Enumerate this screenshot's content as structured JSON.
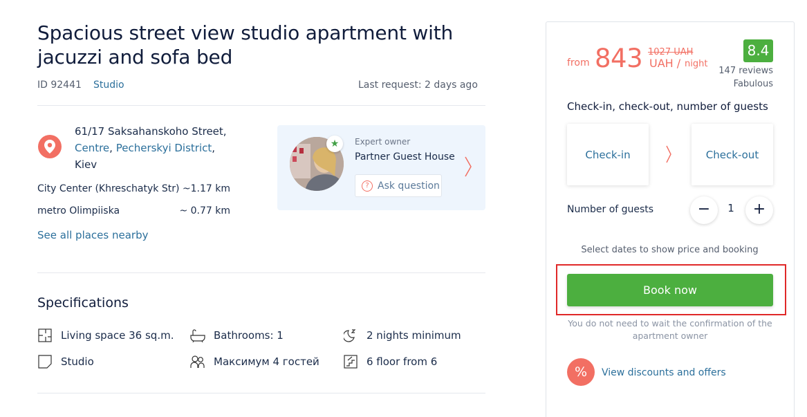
{
  "listing": {
    "title": "Spacious street view studio apartment with jacuzzi and sofa bed",
    "id_label": "ID 92441",
    "type": "Studio",
    "last_request": "Last request: 2 days ago"
  },
  "address": {
    "street": "61/17 Saksahanskoho Street,",
    "district1": "Centre",
    "district2": "Pecherskyi District",
    "city": "Kiev",
    "comma": ","
  },
  "places": [
    {
      "name": "City Center (Khreschatyk Str)",
      "distance": "~1.17 km"
    },
    {
      "name": "metro Olimpiiska",
      "distance": "~ 0.77 km"
    }
  ],
  "see_all": "See all places nearby",
  "owner": {
    "label": "Expert owner",
    "name": "Partner Guest House",
    "ask": "Ask question",
    "ask_icon": "?"
  },
  "specifications": {
    "title": "Specifications",
    "items": [
      {
        "icon": "floorplan-icon",
        "text": "Living space 36 sq.m."
      },
      {
        "icon": "bathtub-icon",
        "text": "Bathrooms: 1"
      },
      {
        "icon": "moon-icon",
        "text": "2 nights minimum"
      },
      {
        "icon": "room-icon",
        "text": "Studio"
      },
      {
        "icon": "guests-icon",
        "text": "Максимум 4 гостей"
      },
      {
        "icon": "stairs-icon",
        "text": "6 floor from 6"
      }
    ]
  },
  "booking": {
    "from": "from",
    "price": "843",
    "old_price": "1027 UAH",
    "currency": "UAH",
    "slash": "/",
    "per": "night",
    "score": "8.4",
    "reviews": "147 reviews",
    "rating_word": "Fabulous",
    "check_heading": "Check-in, check-out, number of guests",
    "check_in": "Check-in",
    "check_out": "Check-out",
    "guests_label": "Number of guests",
    "guests_minus": "−",
    "guests_count": "1",
    "guests_plus": "+",
    "select_dates": "Select dates to show price and booking",
    "book_now": "Book now",
    "no_wait": "You do not need to wait the confirmation of the apartment owner",
    "discount_icon": "%",
    "discounts": "View discounts and offers"
  },
  "colors": {
    "accent": "#f26f63",
    "link": "#2b6f9b",
    "book": "#4caf3f",
    "highlight": "#e02828"
  }
}
